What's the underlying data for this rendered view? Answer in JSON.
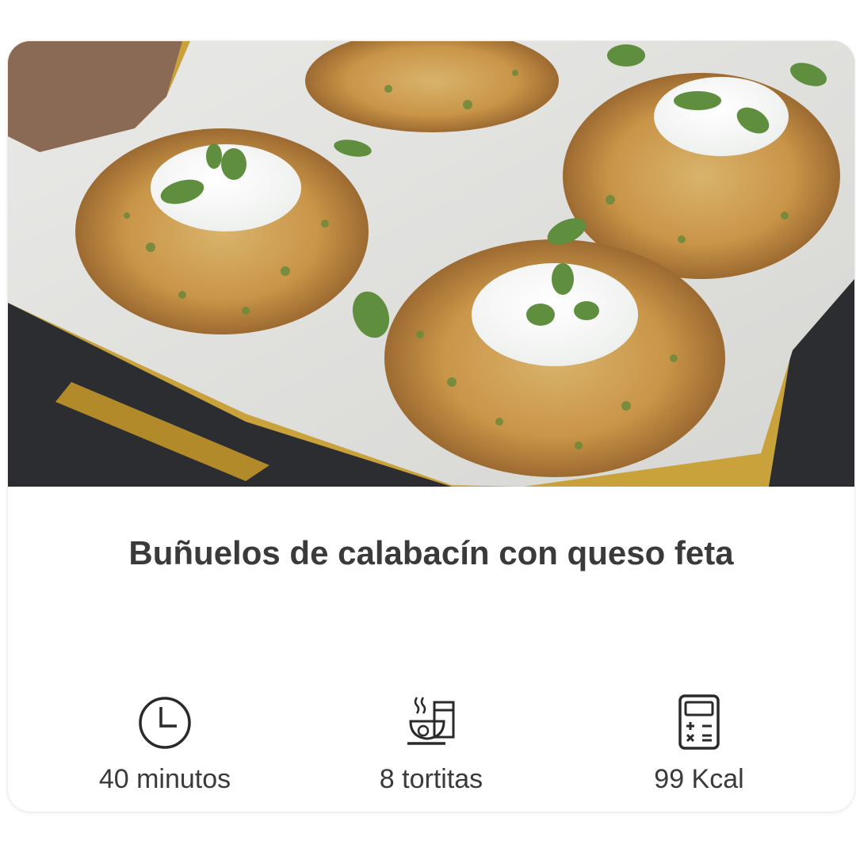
{
  "recipe": {
    "title": "Buñuelos de calabacín con queso feta",
    "photo_icon": "zucchini-fritters-photo"
  },
  "stats": [
    {
      "icon": "clock-icon",
      "label": "40 minutos"
    },
    {
      "icon": "bowl-icon",
      "label": "8 tortitas"
    },
    {
      "icon": "calculator-icon",
      "label": "99 Kcal"
    }
  ],
  "colors": {
    "text": "#3a3a3a",
    "card_bg": "#ffffff",
    "tray": "#2b2d30",
    "parchment": "#e4e4e2",
    "fritter": "#c89a52"
  }
}
